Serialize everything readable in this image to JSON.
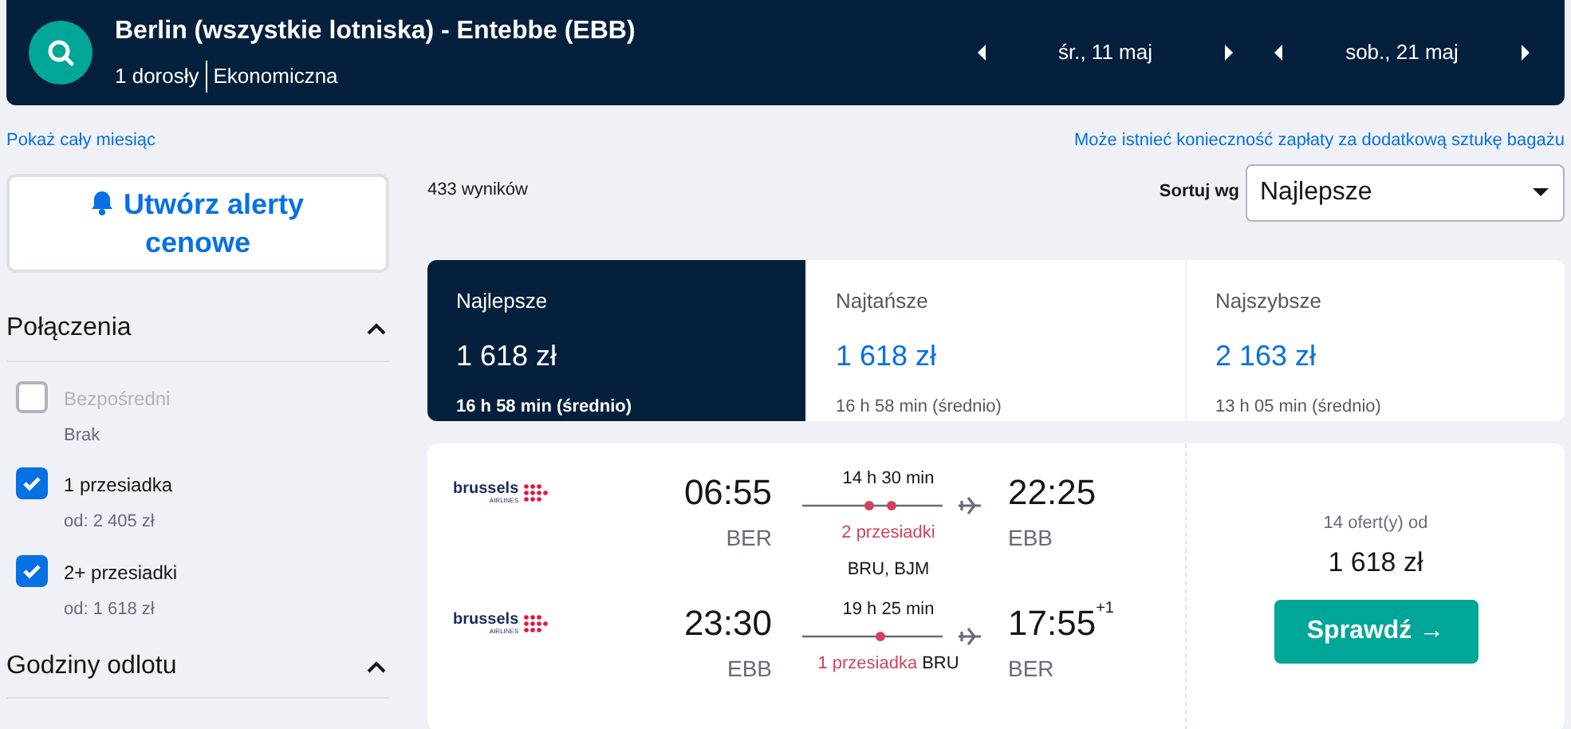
{
  "header": {
    "route": "Berlin (wszystkie lotniska) - Entebbe (EBB)",
    "passengers": "1 dorosły",
    "cabin": "Ekonomiczna",
    "dates": [
      "śr., 11 maj",
      "sob., 21 maj"
    ]
  },
  "links": {
    "month": "Pokaż cały miesiąc",
    "baggage": "Może istnieć konieczność zapłaty za dodatkową sztukę bagażu"
  },
  "alert_button": "Utwórz alerty cenowe",
  "filters": [
    {
      "title": "Połączenia",
      "expanded": true,
      "options": [
        {
          "label": "Bezpośredni",
          "sub": "Brak",
          "checked": false,
          "disabled": true
        },
        {
          "label": "1 przesiadka",
          "sub": "od: 2 405 zł",
          "checked": true,
          "disabled": false
        },
        {
          "label": "2+ przesiadki",
          "sub": "od: 1 618 zł",
          "checked": true,
          "disabled": false
        }
      ]
    },
    {
      "title": "Godziny odlotu",
      "expanded": true
    }
  ],
  "results_count": "433 wyników",
  "sort": {
    "label": "Sortuj wg",
    "value": "Najlepsze"
  },
  "sort_tabs": [
    {
      "label": "Najlepsze",
      "price": "1 618 zł",
      "duration": "16 h 58 min (średnio)",
      "selected": true
    },
    {
      "label": "Najtańsze",
      "price": "1 618 zł",
      "duration": "16 h 58 min (średnio)",
      "selected": false
    },
    {
      "label": "Najszybsze",
      "price": "2 163 zł",
      "duration": "13 h 05 min (średnio)",
      "selected": false
    }
  ],
  "result": {
    "legs": [
      {
        "airline": "brussels",
        "airline_sub": "AIRLINES",
        "depart": "06:55",
        "from": "BER",
        "duration": "14 h 30 min",
        "kind": "two-stop",
        "stops": "2 przesiadki",
        "via": "BRU, BJM",
        "arrive": "22:25",
        "to": "EBB"
      },
      {
        "airline": "brussels",
        "airline_sub": "AIRLINES",
        "depart": "23:30",
        "from": "EBB",
        "duration": "19 h 25 min",
        "kind": "one-stop",
        "stops": "1 przesiadka",
        "via": "BRU",
        "arrive": "17:55",
        "day_offset": "+1",
        "to": "BER"
      }
    ],
    "offers": "14 ofert(y) od",
    "price": "1 618 zł",
    "button": "Sprawdź →"
  }
}
